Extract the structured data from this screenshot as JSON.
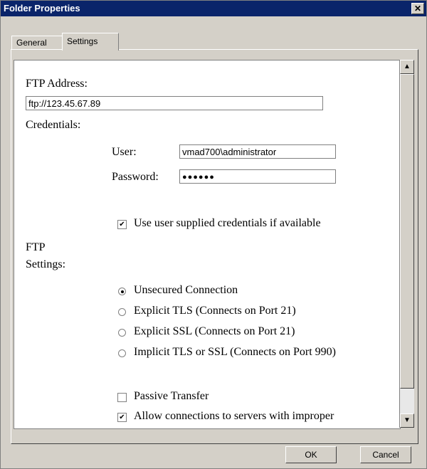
{
  "window": {
    "title": "Folder Properties",
    "close_glyph": "✕"
  },
  "tabs": [
    {
      "label": "General",
      "selected": false
    },
    {
      "label": "Settings",
      "selected": true
    }
  ],
  "form": {
    "ftp_address_label": "FTP Address:",
    "ftp_address_value": "ftp://123.45.67.89",
    "credentials_label": "Credentials:",
    "user_label": "User:",
    "user_value": "vmad700\\administrator",
    "password_label": "Password:",
    "password_mask": "●●●●●●",
    "use_supplied_label": "Use user supplied credentials if available",
    "ftp_settings_label_line1": "FTP",
    "ftp_settings_label_line2": "Settings:",
    "options": [
      {
        "label": "Unsecured Connection",
        "selected": true
      },
      {
        "label": "Explicit TLS (Connects on Port 21)",
        "selected": false
      },
      {
        "label": "Explicit SSL (Connects on Port 21)",
        "selected": false
      },
      {
        "label": "Implicit TLS or SSL (Connects on Port 990)",
        "selected": false
      }
    ],
    "passive_transfer_label": "Passive Transfer",
    "passive_transfer_checked": false,
    "allow_improper_label": "Allow connections to servers with improper",
    "allow_improper_checked": true
  },
  "buttons": {
    "ok": "OK",
    "cancel": "Cancel"
  },
  "icons": {
    "check_glyph": "✔",
    "scroll_up": "▲",
    "scroll_down": "▼"
  }
}
